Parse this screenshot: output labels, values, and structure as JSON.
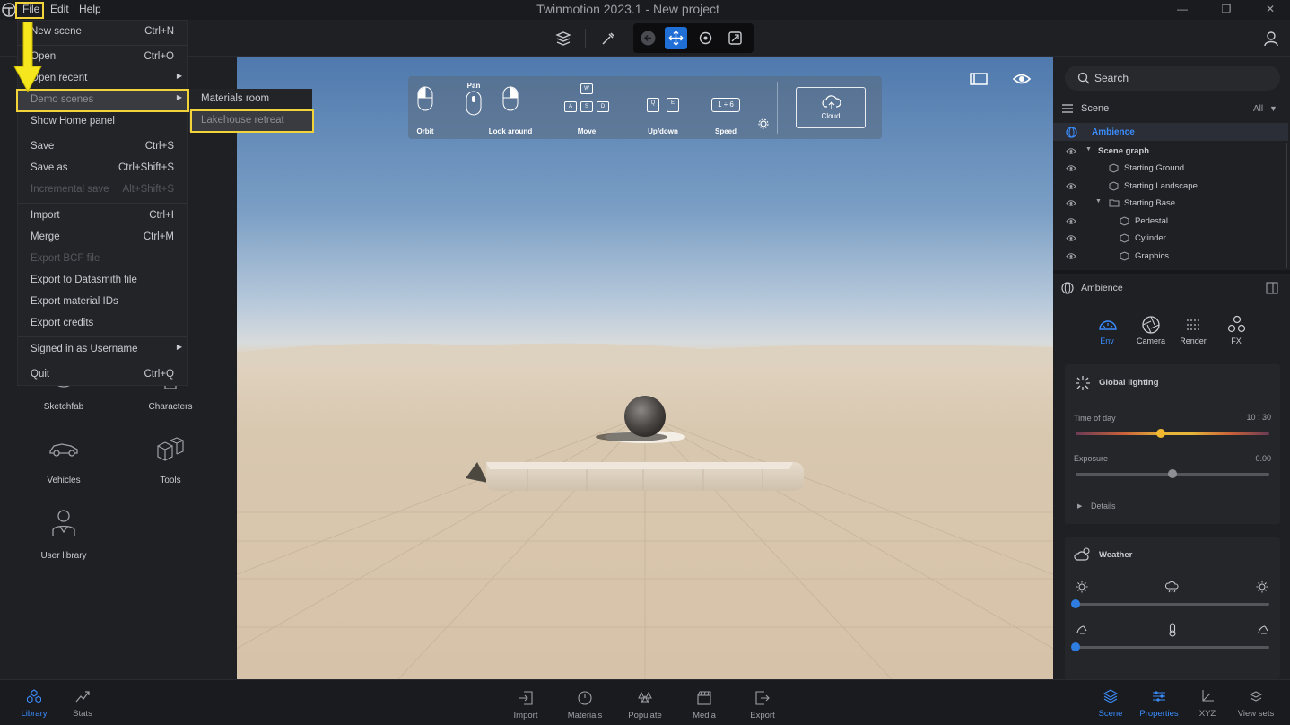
{
  "app": {
    "title": "Twinmotion 2023.1  -  New project",
    "menus": [
      "File",
      "Edit",
      "Help"
    ]
  },
  "file_menu": {
    "items": [
      {
        "label": "New scene",
        "shortcut": "Ctrl+N"
      },
      {
        "label": "Open",
        "shortcut": "Ctrl+O"
      },
      {
        "label": "Open recent",
        "shortcut": ""
      },
      {
        "label": "Demo scenes",
        "shortcut": ""
      },
      {
        "label": "Show Home panel",
        "shortcut": ""
      },
      {
        "label": "Save",
        "shortcut": "Ctrl+S"
      },
      {
        "label": "Save as",
        "shortcut": "Ctrl+Shift+S"
      },
      {
        "label": "Incremental save",
        "shortcut": "Alt+Shift+S"
      },
      {
        "label": "Import",
        "shortcut": "Ctrl+I"
      },
      {
        "label": "Merge",
        "shortcut": "Ctrl+M"
      },
      {
        "label": "Export BCF file",
        "shortcut": ""
      },
      {
        "label": "Export to Datasmith file",
        "shortcut": ""
      },
      {
        "label": "Export material IDs",
        "shortcut": ""
      },
      {
        "label": "Export credits",
        "shortcut": ""
      },
      {
        "label": "Signed in as Username",
        "shortcut": ""
      },
      {
        "label": "Quit",
        "shortcut": "Ctrl+Q"
      }
    ],
    "submenu": [
      "Materials room",
      "Lakehouse retreat"
    ]
  },
  "library": {
    "tiles": [
      "Sketchfab",
      "Characters",
      "Vehicles",
      "Tools",
      "User library"
    ]
  },
  "nav_help": {
    "orbit": "Orbit",
    "pan": "Pan",
    "look_around": "Look around",
    "move": "Move",
    "updown": "Up/down",
    "speed": "Speed",
    "speed_value": "1 ÷ 6",
    "cloud": "Cloud",
    "keys": {
      "w": "W",
      "a": "A",
      "s": "S",
      "d": "D",
      "q": "Q",
      "e": "E"
    }
  },
  "right_panel": {
    "search_placeholder": "Search",
    "scene_header": "Scene",
    "filter": "All",
    "ambience": "Ambience",
    "tree": [
      {
        "label": "Scene graph"
      },
      {
        "label": "Starting Ground"
      },
      {
        "label": "Starting Landscape"
      },
      {
        "label": "Starting Base"
      },
      {
        "label": "Pedestal"
      },
      {
        "label": "Cylinder"
      },
      {
        "label": "Graphics"
      }
    ],
    "props_title": "Ambience",
    "props_tabs": [
      "Env",
      "Camera",
      "Render",
      "FX"
    ],
    "global_lighting": {
      "title": "Global lighting",
      "time_label": "Time of day",
      "time_value": "10 : 30",
      "time_fraction": 0.44,
      "exposure_label": "Exposure",
      "exposure_value": "0.00",
      "exposure_fraction": 0.5,
      "details": "Details"
    },
    "weather": {
      "title": "Weather",
      "weather_fraction": 0.0,
      "temperature_fraction": 0.0
    }
  },
  "bottom_left": [
    "Library",
    "Stats"
  ],
  "bottom_center": [
    "Import",
    "Materials",
    "Populate",
    "Media",
    "Export"
  ],
  "bottom_right": [
    "Scene",
    "Properties",
    "XYZ",
    "View sets"
  ],
  "colors": {
    "accent": "#2f7de1",
    "highlight": "#f2d43a"
  }
}
